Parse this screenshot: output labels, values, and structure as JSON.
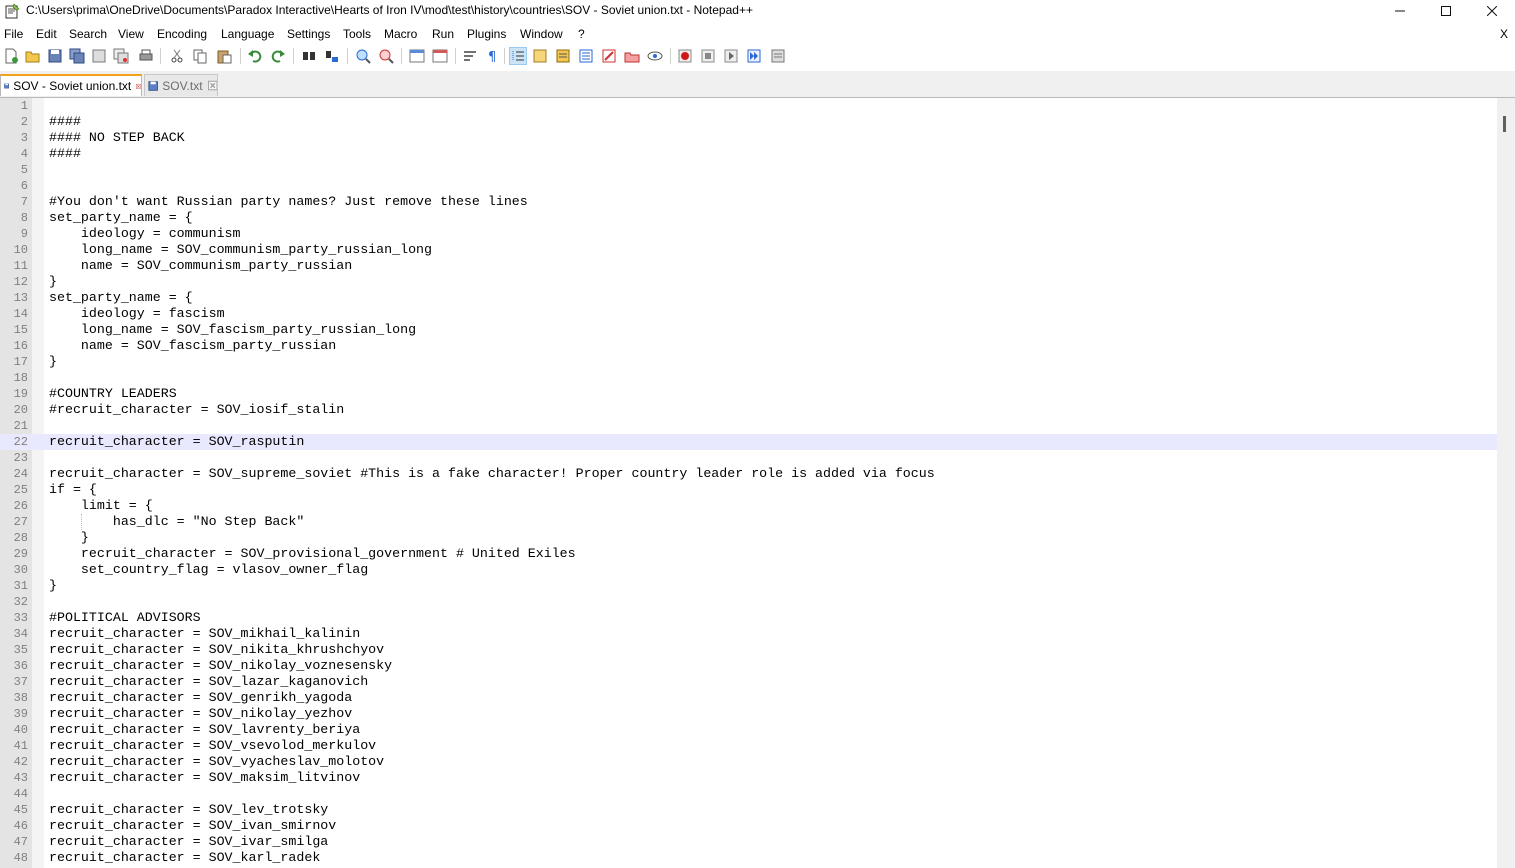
{
  "window": {
    "title": "C:\\Users\\prima\\OneDrive\\Documents\\Paradox Interactive\\Hearts of Iron IV\\mod\\test\\history\\countries\\SOV - Soviet union.txt - Notepad++",
    "minimize_glyph": "—",
    "maximize_glyph": "☐",
    "close_glyph": "✕"
  },
  "menu": {
    "items": [
      "File",
      "Edit",
      "Search",
      "View",
      "Encoding",
      "Language",
      "Settings",
      "Tools",
      "Macro",
      "Run",
      "Plugins",
      "Window",
      "?"
    ],
    "close_doc": "X"
  },
  "toolbar": {
    "icons": [
      "new-file-icon",
      "open-file-icon",
      "save-icon",
      "save-all-icon",
      "close-icon",
      "close-all-icon",
      "print-icon",
      "cut-icon",
      "copy-icon",
      "paste-icon",
      "undo-icon",
      "redo-icon",
      "find-icon",
      "replace-icon",
      "zoom-in-icon",
      "zoom-out-icon",
      "sync-vertical-icon",
      "sync-horizontal-icon",
      "word-wrap-icon",
      "show-all-chars-icon",
      "indent-guide-icon",
      "udl-icon",
      "doc-map-icon",
      "function-list-icon",
      "folder-workspace-icon",
      "monitoring-icon",
      "eye-icon",
      "record-macro-icon",
      "stop-macro-icon",
      "play-macro-icon",
      "run-macro-multiple-icon",
      "save-macro-icon"
    ],
    "active_icon": "indent-guide-icon"
  },
  "tabs": [
    {
      "label": "SOV - Soviet union.txt",
      "active": true,
      "color": "#000000"
    },
    {
      "label": "SOV.txt",
      "active": false,
      "color": "#6d6d6d"
    }
  ],
  "editor": {
    "current_line": 22,
    "current_line_color": "#e8e8ff",
    "lines": [
      "",
      "####",
      "#### NO STEP BACK",
      "####",
      "",
      "",
      "#You don't want Russian party names? Just remove these lines",
      "set_party_name = {",
      "    ideology = communism",
      "    long_name = SOV_communism_party_russian_long",
      "    name = SOV_communism_party_russian",
      "}",
      "set_party_name = {",
      "    ideology = fascism",
      "    long_name = SOV_fascism_party_russian_long",
      "    name = SOV_fascism_party_russian",
      "}",
      "",
      "#COUNTRY LEADERS",
      "#recruit_character = SOV_iosif_stalin",
      "",
      "recruit_character = SOV_rasputin",
      "",
      "recruit_character = SOV_supreme_soviet #This is a fake character! Proper country leader role is added via focus",
      "if = {",
      "    limit = {",
      "        has_dlc = \"No Step Back\"",
      "    }",
      "    recruit_character = SOV_provisional_government # United Exiles",
      "    set_country_flag = vlasov_owner_flag",
      "}",
      "",
      "#POLITICAL ADVISORS",
      "recruit_character = SOV_mikhail_kalinin",
      "recruit_character = SOV_nikita_khrushchyov",
      "recruit_character = SOV_nikolay_voznesensky",
      "recruit_character = SOV_lazar_kaganovich",
      "recruit_character = SOV_genrikh_yagoda",
      "recruit_character = SOV_nikolay_yezhov",
      "recruit_character = SOV_lavrenty_beriya",
      "recruit_character = SOV_vsevolod_merkulov",
      "recruit_character = SOV_vyacheslav_molotov",
      "recruit_character = SOV_maksim_litvinov",
      "",
      "recruit_character = SOV_lev_trotsky",
      "recruit_character = SOV_ivan_smirnov",
      "recruit_character = SOV_ivar_smilga",
      "recruit_character = SOV_karl_radek"
    ]
  }
}
